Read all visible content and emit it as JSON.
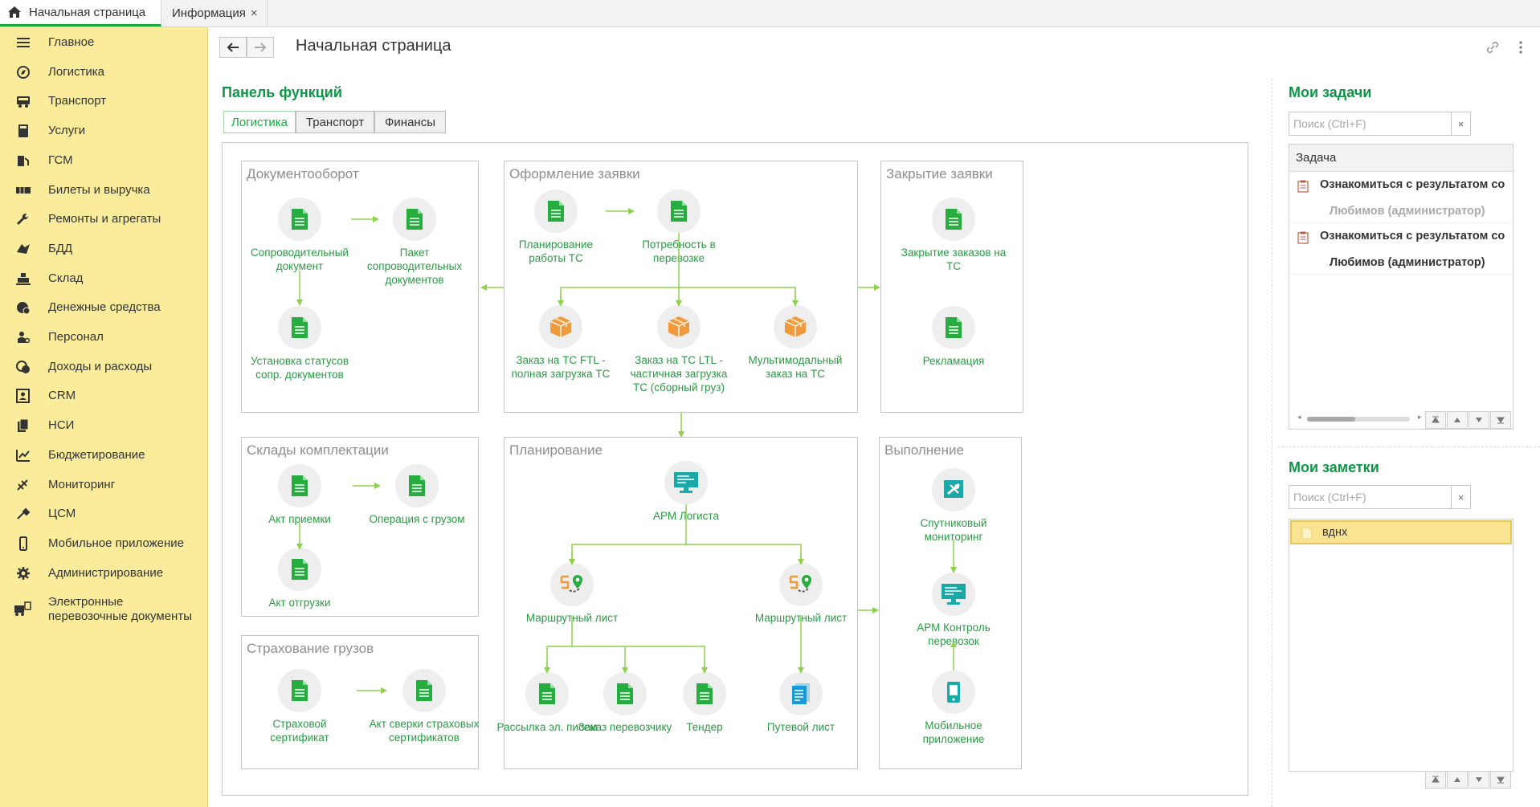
{
  "tabs": [
    {
      "label": "Начальная страница",
      "active": true
    },
    {
      "label": "Информация",
      "active": false
    }
  ],
  "sidebar": {
    "items": [
      {
        "label": "Главное",
        "icon": "menu-icon"
      },
      {
        "label": "Логистика",
        "icon": "compass-icon"
      },
      {
        "label": "Транспорт",
        "icon": "truck-icon"
      },
      {
        "label": "Услуги",
        "icon": "calculator-icon"
      },
      {
        "label": "ГСМ",
        "icon": "fuel-icon"
      },
      {
        "label": "Билеты и выручка",
        "icon": "ticket-icon"
      },
      {
        "label": "Ремонты и агрегаты",
        "icon": "wrench-icon"
      },
      {
        "label": "БДД",
        "icon": "road-safety-icon"
      },
      {
        "label": "Склад",
        "icon": "warehouse-icon"
      },
      {
        "label": "Денежные средства",
        "icon": "money-icon"
      },
      {
        "label": "Персонал",
        "icon": "person-icon"
      },
      {
        "label": "Доходы и расходы",
        "icon": "coins-icon"
      },
      {
        "label": "CRM",
        "icon": "crm-icon"
      },
      {
        "label": "НСИ",
        "icon": "reference-icon"
      },
      {
        "label": "Бюджетирование",
        "icon": "budget-icon"
      },
      {
        "label": "Мониторинг",
        "icon": "satellite-icon"
      },
      {
        "label": "ЦСМ",
        "icon": "tools-icon"
      },
      {
        "label": "Мобильное приложение",
        "icon": "mobile-icon"
      },
      {
        "label": "Администрирование",
        "icon": "gear-icon"
      },
      {
        "label": "Электронные перевозочные документы",
        "icon": "e-docs-icon"
      }
    ]
  },
  "header": {
    "title": "Начальная страница"
  },
  "function_panel": {
    "title": "Панель функций",
    "tabs": [
      "Логистика",
      "Транспорт",
      "Финансы"
    ]
  },
  "diagram": {
    "boxes": {
      "docflow": "Документооборот",
      "order": "Оформление заявки",
      "closing": "Закрытие заявки",
      "warehouses": "Склады комплектации",
      "planning": "Планирование",
      "execution": "Выполнение",
      "insurance": "Страхование грузов"
    },
    "nodes": {
      "n1": "Сопроводительный документ",
      "n2": "Пакет сопроводительных документов",
      "n3": "Установка статусов сопр. документов",
      "n4": "Планирование работы ТС",
      "n5": "Потребность в перевозке",
      "n6": "Заказ на ТС FTL - полная загрузка ТС",
      "n7": "Заказ на ТС LTL - частичная загрузка ТС (сборный груз)",
      "n8": "Мультимодальный заказ на ТС",
      "n9": "Закрытие заказов на ТС",
      "n10": "Рекламация",
      "n11": "Акт приемки",
      "n12": "Операция с грузом",
      "n13": "Акт отгрузки",
      "n14": "АРМ Логиста",
      "n15": "Маршрутный лист",
      "n16": "Маршрутный лист",
      "n17": "Рассылка эл. писем",
      "n18": "Заказ перевозчику",
      "n19": "Тендер",
      "n20": "Путевой лист",
      "n21": "Спутниковый мониторинг",
      "n22": "АРМ Контроль перевозок",
      "n23": "Мобильное приложение",
      "n24": "Страховой сертификат",
      "n25": "Акт сверки страховых сертификатов"
    }
  },
  "tasks": {
    "title": "Мои задачи",
    "search_placeholder": "Поиск (Ctrl+F)",
    "column": "Задача",
    "rows": [
      {
        "title": "Ознакомиться с результатом со",
        "author": "Любимов (администратор)"
      },
      {
        "title": "Ознакомиться с результатом со",
        "author": "Любимов (администратор)"
      }
    ]
  },
  "notes": {
    "title": "Мои заметки",
    "search_placeholder": "Поиск (Ctrl+F)",
    "items": [
      "вднх"
    ]
  },
  "colors": {
    "accent": "#1aab40",
    "sidebar": "#fbec9c",
    "doc_icon": "#27ad3f",
    "box_icon": "#f09a3e",
    "monitor_icon": "#1aa8a8"
  }
}
